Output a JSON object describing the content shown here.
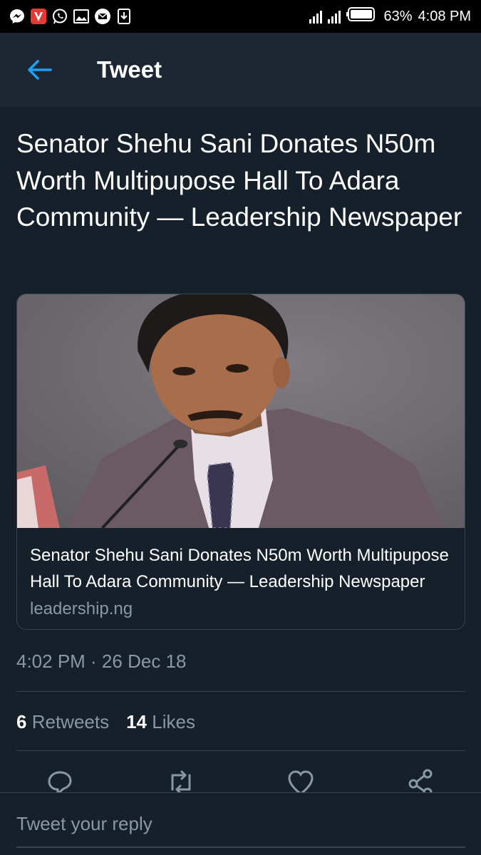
{
  "status_bar": {
    "battery_percent": "63%",
    "time": "4:08 PM",
    "app_icons": [
      "messenger-icon",
      "vidmate-icon",
      "whatsapp-icon",
      "gallery-icon",
      "email-icon",
      "download-icon"
    ]
  },
  "header": {
    "title": "Tweet"
  },
  "tweet": {
    "text": "Senator Shehu Sani Donates N50m Worth Multipupose Hall To Adara Community — Leadership Newspaper",
    "card": {
      "title": "Senator Shehu Sani Donates N50m Worth Multipupose Hall To Adara Community — Leadership Newspaper",
      "domain": "leadership.ng"
    },
    "timestamp": "4:02 PM · 26 Dec 18",
    "retweets_count": "6",
    "retweets_label": "Retweets",
    "likes_count": "14",
    "likes_label": "Likes"
  },
  "reply": {
    "placeholder": "Tweet your reply"
  },
  "colors": {
    "background": "#15202b",
    "header_bg": "#1c2733",
    "accent": "#1da1f2",
    "secondary_text": "#8899a6",
    "border": "#38444d"
  }
}
